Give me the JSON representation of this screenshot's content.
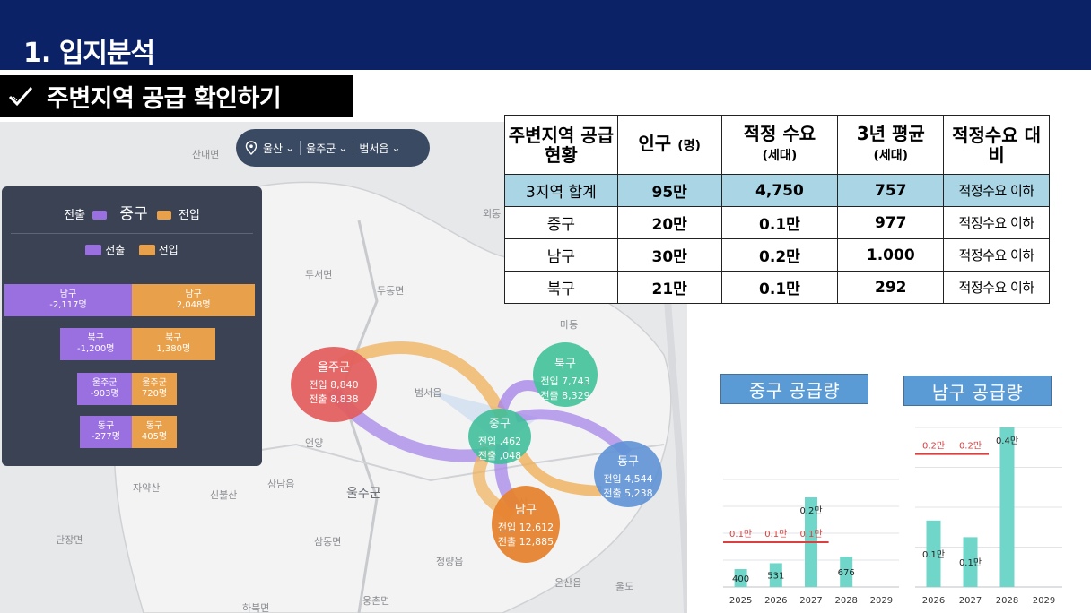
{
  "header": {
    "title": "1. 입지분석"
  },
  "subheader": {
    "title": "주변지역 공급 확인하기",
    "icon": "checkmark-icon"
  },
  "map": {
    "selector": {
      "items": [
        "울산",
        "울주군",
        "범서읍"
      ],
      "icon": "location-pin-icon"
    },
    "labels": {
      "l1": "산내면",
      "l2": "두서면",
      "l3": "두동면",
      "l4": "범서읍",
      "l5": "울주군",
      "l6": "삼남읍",
      "l7": "삼동면",
      "l8": "단장면",
      "l9": "하북면",
      "l10": "웅촌면",
      "l11": "청량읍",
      "l12": "외동",
      "l13": "마동",
      "l14": "언양",
      "l15": "신불산",
      "l16": "자약산",
      "l17": "울산",
      "l18": "온산읍",
      "l19": "울도"
    },
    "flow_panel": {
      "head_left": "전출",
      "head_center": "중구",
      "head_right": "전입",
      "legend_out": "전출",
      "legend_in": "전입",
      "colors": {
        "out": "#9a6fe0",
        "in": "#e8a04a"
      },
      "rows": [
        {
          "out_label": "남구",
          "out_value": "-2,117명",
          "in_label": "남구",
          "in_value": "2,048명",
          "out": 2117,
          "in": 2048
        },
        {
          "out_label": "북구",
          "out_value": "-1,200명",
          "in_label": "북구",
          "in_value": "1,380명",
          "out": 1200,
          "in": 1380
        },
        {
          "out_label": "울주군",
          "out_value": "-903명",
          "in_label": "울주군",
          "in_value": "720명",
          "out": 903,
          "in": 720
        },
        {
          "out_label": "동구",
          "out_value": "-277명",
          "in_label": "동구",
          "in_value": "405명",
          "out": 277,
          "in": 405
        }
      ]
    },
    "bubbles": [
      {
        "name": "울주군",
        "in": "전입 8,840",
        "out": "전출 8,838",
        "color": "#e35d5d"
      },
      {
        "name": "북구",
        "in": "전입 7,743",
        "out": "전출 8,329",
        "color": "#45c49a"
      },
      {
        "name": "중구",
        "in": "전입 ,462",
        "out": "전출 ,048",
        "color": "#3fbf9a"
      },
      {
        "name": "동구",
        "in": "전입 4,544",
        "out": "전출 5,238",
        "color": "#5f93d6"
      },
      {
        "name": "남구",
        "in": "전입 12,612",
        "out": "전출 12,885",
        "color": "#e7832f"
      }
    ]
  },
  "table": {
    "headers": [
      "주변지역 공급현황",
      "인구",
      "(명)",
      "적정 수요",
      "(세대)",
      "3년 평균",
      "(세대)",
      "적정수요 대비"
    ],
    "rows": [
      [
        "3지역 합계",
        "95만",
        "4,750",
        "757",
        "적정수요 이하"
      ],
      [
        "중구",
        "20만",
        "0.1만",
        "977",
        "적정수요 이하"
      ],
      [
        "남구",
        "30만",
        "0.2만",
        "1.000",
        "적정수요 이하"
      ],
      [
        "북구",
        "21만",
        "0.1만",
        "292",
        "적정수요 이하"
      ]
    ],
    "highlight_color": "#a9d5e5"
  },
  "chart_data": [
    {
      "type": "bar",
      "title": "중구 공급량",
      "categories": [
        "2025",
        "2026",
        "2027",
        "2028",
        "2029"
      ],
      "values": [
        400,
        531,
        2000,
        676,
        0
      ],
      "data_labels": [
        "400",
        "531",
        "0.2만",
        "676",
        ""
      ],
      "reference_line": {
        "value": 1000,
        "labels": [
          "0.1만",
          "0.1만",
          "0.1만"
        ],
        "color": "#d9403f"
      },
      "ylim": [
        0,
        2400
      ],
      "bar_color": "#6fd6c9"
    },
    {
      "type": "bar",
      "title": "남구 공급량",
      "categories": [
        "2026",
        "2027",
        "2028",
        "2029"
      ],
      "values": [
        1000,
        750,
        2400,
        0
      ],
      "data_labels": [
        "0.1만",
        "0.1만",
        "0.4만",
        ""
      ],
      "reference_line": {
        "value": 2000,
        "labels": [
          "0.2만",
          "0.2만"
        ],
        "color": "#d9403f"
      },
      "ylim": [
        0,
        2400
      ],
      "bar_color": "#6fd6c9"
    }
  ]
}
